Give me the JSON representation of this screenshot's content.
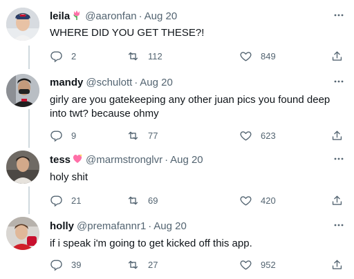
{
  "tweets": [
    {
      "name": "leila",
      "name_emoji": "tulip-emoji",
      "handle": "@aaronfan",
      "separator": "·",
      "date": "Aug 20",
      "text": "WHERE DID YOU GET THESE?!",
      "replies": "2",
      "retweets": "112",
      "likes": "849"
    },
    {
      "name": "mandy",
      "name_emoji": "",
      "handle": "@schulott",
      "separator": "·",
      "date": "Aug 20",
      "text": "girly are you gatekeeping any other juan pics you found deep into twt? because ohmy",
      "replies": "9",
      "retweets": "77",
      "likes": "623"
    },
    {
      "name": "tess",
      "name_emoji": "sparkling-heart-emoji",
      "handle": "@marmstronglvr",
      "separator": "·",
      "date": "Aug 20",
      "text": "holy shit",
      "replies": "21",
      "retweets": "69",
      "likes": "420"
    },
    {
      "name": "holly",
      "name_emoji": "",
      "handle": "@premafannr1",
      "separator": "·",
      "date": "Aug 20",
      "text": "if i speak i'm going to get kicked off this app.",
      "replies": "39",
      "retweets": "27",
      "likes": "952"
    }
  ],
  "colors": {
    "text": "#0f1419",
    "secondary": "#536471",
    "thread_line": "#cfd9de",
    "emoji_pink": "#ff6fa8"
  },
  "icons": {
    "reply": "reply-icon",
    "retweet": "retweet-icon",
    "like": "like-icon",
    "share": "share-icon",
    "more": "more-icon"
  }
}
